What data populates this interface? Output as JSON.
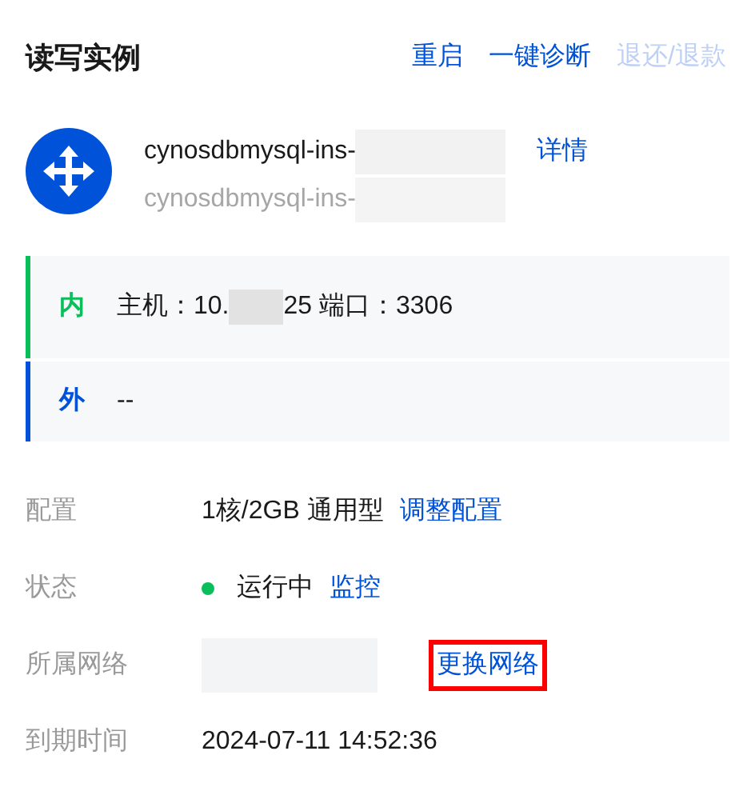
{
  "title": "读写实例",
  "actions": [
    {
      "label": "重启",
      "disabled": false
    },
    {
      "label": "一键诊断",
      "disabled": false
    },
    {
      "label": "退还/退款",
      "disabled": true
    }
  ],
  "instance": {
    "id": "cynosdbmysql-ins-",
    "name": "cynosdbmysql-ins-",
    "link": "详情"
  },
  "endpoints": [
    {
      "kind": "inner",
      "badge": "内",
      "color": "#0abf5b",
      "parts": [
        "主机：10.",
        "25 端口：3306"
      ]
    },
    {
      "kind": "outer",
      "badge": "外",
      "color": "#0052d9",
      "parts": [
        "--"
      ]
    }
  ],
  "fields": [
    {
      "kind": "text",
      "label": "配置",
      "value": "1核/2GB 通用型",
      "link": "调整配置"
    },
    {
      "kind": "status",
      "label": "状态",
      "value": "运行中",
      "color": "#0abf5b",
      "link": "监控"
    },
    {
      "kind": "redacted",
      "label": "所属网络",
      "link": "更换网络",
      "highlighted": true
    },
    {
      "kind": "text",
      "label": "到期时间",
      "value": "2024-07-11 14:52:36"
    }
  ]
}
